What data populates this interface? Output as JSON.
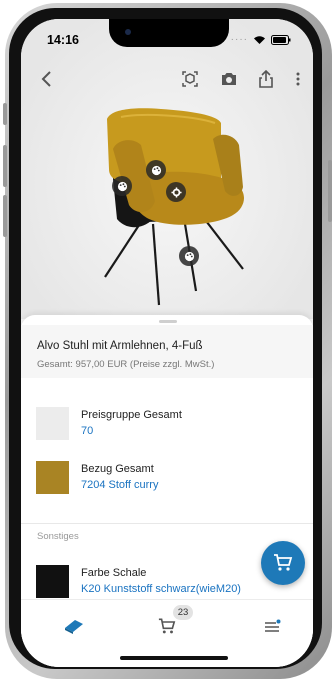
{
  "status_bar": {
    "time": "14:16"
  },
  "product": {
    "name": "Alvo Stuhl mit Armlehnen, 4-Fuß",
    "total": "Gesamt: 957,00 EUR (Preise zzgl. MwSt.)"
  },
  "options": [
    {
      "label": "Preisgruppe Gesamt",
      "value": "70",
      "swatch_color": "#ececec"
    },
    {
      "label": "Bezug Gesamt",
      "value": "7204 Stoff curry",
      "swatch_color": "#a98424"
    }
  ],
  "section_other": "Sonstiges",
  "other_options": [
    {
      "label": "Farbe Schale",
      "value": "K20 Kunststoff schwarz(wieM20)",
      "swatch_color": "#111111"
    }
  ],
  "cart": {
    "count": "23"
  },
  "colors": {
    "accent": "#1e79b8",
    "link": "#1a73c1",
    "chair_fabric": "#c79a1e"
  },
  "icons": {
    "back": "chevron-left-icon",
    "ar": "ar-cube-icon",
    "camera": "camera-icon",
    "share": "share-icon",
    "more": "more-vertical-icon",
    "fab": "cart-icon",
    "nav": [
      "catalog-icon",
      "cart-icon",
      "menu-icon"
    ]
  }
}
